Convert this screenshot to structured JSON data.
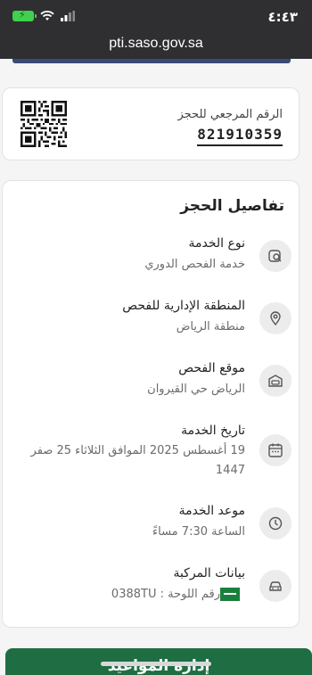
{
  "status_bar": {
    "time": "٤:٤٣"
  },
  "browser": {
    "url": "pti.saso.gov.sa"
  },
  "reference": {
    "label": "الرقم المرجعي للحجز",
    "number": "821910359"
  },
  "details": {
    "title": "تفاصيل الحجز",
    "rows": [
      {
        "label": "نوع الخدمة",
        "value": "خدمة الفحص الدوري",
        "icon": "inspection-icon"
      },
      {
        "label": "المنطقة الإدارية للفحص",
        "value": "منطقة الرياض",
        "icon": "location-pin-icon"
      },
      {
        "label": "موقع الفحص",
        "value": "الرياض حي القيروان",
        "icon": "garage-icon"
      },
      {
        "label": "تاريخ الخدمة",
        "value": "19 أغسطس 2025   الموافق   الثلاثاء 25 صفر 1447",
        "icon": "calendar-icon"
      },
      {
        "label": "موعد الخدمة",
        "value": "الساعة  7:30 مساءً",
        "icon": "clock-icon"
      },
      {
        "label": "بيانات المركبة",
        "value": "رقم اللوحة : 0388TU",
        "icon": "car-icon"
      }
    ]
  },
  "bottom_button": {
    "label": "إدارة المواعيد"
  }
}
